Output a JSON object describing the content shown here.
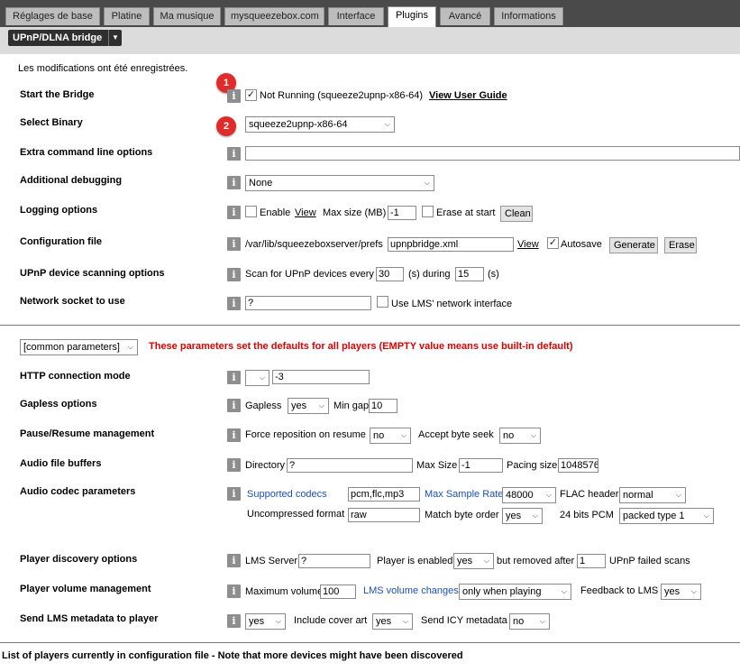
{
  "tabs": [
    "Réglages de base",
    "Platine",
    "Ma musique",
    "mysqueezebox.com",
    "Interface",
    "Plugins",
    "Avancé",
    "Informations"
  ],
  "active_tab": "Plugins",
  "plugin_selector": "UPnP/DLNA bridge",
  "saved_message": "Les modifications ont été enregistrées.",
  "badges": [
    "1",
    "2"
  ],
  "info_icon": "i",
  "rows": {
    "start_bridge": {
      "label": "Start the Bridge",
      "status": "Not Running (squeeze2upnp-x86-64)",
      "guide_link": "View User Guide"
    },
    "select_binary": {
      "label": "Select Binary",
      "value": "squeeze2upnp-x86-64"
    },
    "extra_cmd": {
      "label": "Extra command line options",
      "value": ""
    },
    "debugging": {
      "label": "Additional debugging",
      "value": "None"
    },
    "logging": {
      "label": "Logging options",
      "enable": "Enable",
      "view": "View",
      "max_size_label": "Max size (MB)",
      "max_size_value": "-1",
      "erase_at_start": "Erase at start",
      "clean": "Clean"
    },
    "config_file": {
      "label": "Configuration file",
      "path": "/var/lib/squeezeboxserver/prefs",
      "file": "upnpbridge.xml",
      "view": "View",
      "autosave": "Autosave",
      "generate": "Generate",
      "erase": "Erase"
    },
    "scanning": {
      "label": "UPnP device scanning options",
      "prefix": "Scan for UPnP devices every",
      "every_value": "30",
      "during_label": "(s) during",
      "during_value": "15",
      "suffix": "(s)"
    },
    "socket": {
      "label": "Network socket to use",
      "value": "?",
      "use_lms": "Use LMS' network interface"
    }
  },
  "params": {
    "selector": "[common parameters]",
    "note": "These parameters set the defaults for all players (EMPTY value means use built-in default)",
    "http": {
      "label": "HTTP connection mode",
      "select": "",
      "value": "-3"
    },
    "gapless": {
      "label": "Gapless options",
      "gapless": "Gapless",
      "gapless_value": "yes",
      "min_gap": "Min gap",
      "min_gap_value": "10"
    },
    "pause": {
      "label": "Pause/Resume management",
      "force": "Force reposition on resume",
      "force_value": "no",
      "accept": "Accept byte seek",
      "accept_value": "no"
    },
    "buffers": {
      "label": "Audio file buffers",
      "directory": "Directory",
      "directory_value": "?",
      "max_size": "Max Size",
      "max_size_value": "-1",
      "pacing": "Pacing size",
      "pacing_value": "1048576"
    },
    "codec": {
      "label": "Audio codec parameters",
      "supported": "Supported codecs",
      "codecs_value": "pcm,flc,mp3",
      "max_rate": "Max Sample Rate",
      "max_rate_value": "48000",
      "flac": "FLAC header",
      "flac_value": "normal",
      "uncompressed": "Uncompressed format",
      "uncompressed_value": "raw",
      "match": "Match byte order",
      "match_value": "yes",
      "bits24": "24 bits PCM",
      "bits24_value": "packed type 1"
    },
    "discovery": {
      "label": "Player discovery options",
      "lms_server": "LMS Server",
      "lms_server_value": "?",
      "enabled": "Player is enabled",
      "enabled_value": "yes",
      "removed": "but removed after",
      "removed_value": "1",
      "failed": "UPnP failed scans"
    },
    "volume": {
      "label": "Player volume management",
      "max_volume": "Maximum volume",
      "max_volume_value": "100",
      "changes": "LMS volume changes",
      "changes_value": "only when playing",
      "feedback": "Feedback to LMS",
      "feedback_value": "yes"
    },
    "metadata": {
      "label": "Send LMS metadata to player",
      "metadata_value": "yes",
      "cover": "Include cover art",
      "cover_value": "yes",
      "icy": "Send ICY metadata",
      "icy_value": "no"
    }
  },
  "footer": "List of players currently in configuration file - Note that more devices might have been discovered"
}
